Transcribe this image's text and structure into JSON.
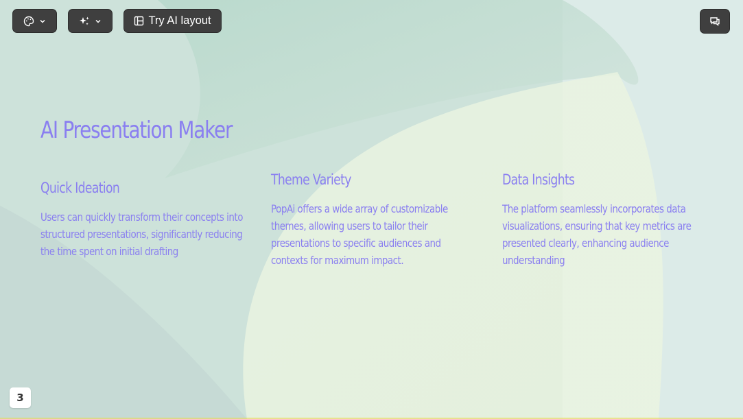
{
  "toolbar": {
    "theme_button_icon": "palette-icon",
    "magic_button_icon": "sparkles-icon",
    "layout_button_label": "Try AI layout",
    "layout_button_icon": "layout-icon",
    "comment_button_icon": "comments-icon"
  },
  "slide": {
    "title": "AI Presentation Maker",
    "columns": [
      {
        "heading": "Quick Ideation",
        "text": "Users can quickly transform their concepts into structured presentations, significantly reducing the time spent on initial drafting"
      },
      {
        "heading": "Theme Variety",
        "text": "PopAi offers a wide array of customizable themes, allowing users to tailor their presentations to specific audiences and contexts for maximum impact."
      },
      {
        "heading": "Data Insights",
        "text": "The platform seamlessly incorporates data visualizations, ensuring that key metrics are presented clearly, enhancing audience understanding"
      }
    ],
    "page_number": "3"
  },
  "colors": {
    "accent_text": "#8a7ff0",
    "button_bg": "#3f3f3f"
  }
}
